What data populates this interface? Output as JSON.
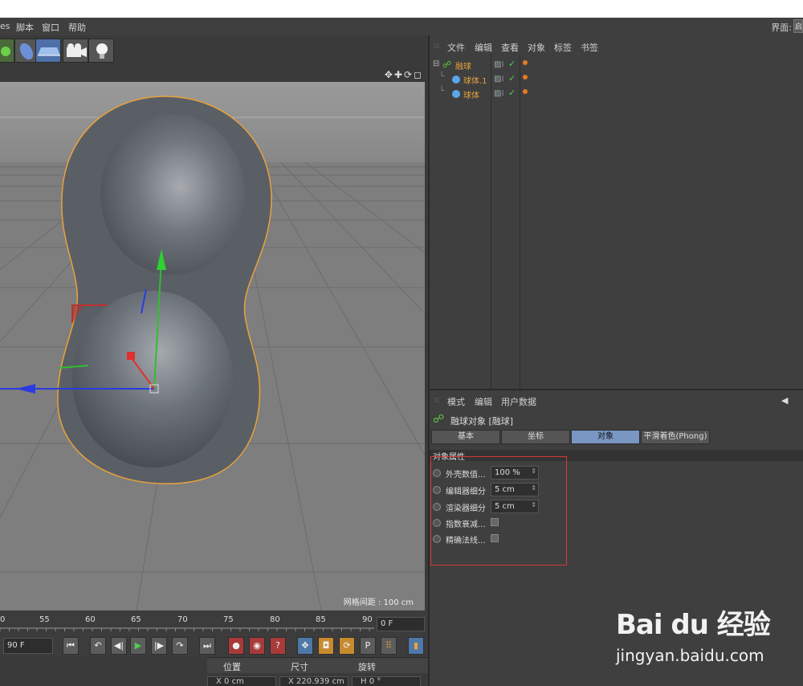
{
  "menubar": {
    "items": [
      "es",
      "脚本",
      "窗口",
      "帮助"
    ],
    "layout_label": "界面:",
    "layout_value": "启"
  },
  "viewport": {
    "grid_spacing": "网格间距 : 100 cm",
    "nav_icons": "✥✚⟳◻"
  },
  "timeline": {
    "ticks": [
      "0",
      "55",
      "60",
      "65",
      "70",
      "75",
      "80",
      "85",
      "90"
    ],
    "current_frame": "0 F"
  },
  "transport": {
    "end_frame": "90 F",
    "buttons": [
      "⏮",
      "↶",
      "◀|",
      "▶",
      "|▶",
      "↷",
      "⏭"
    ]
  },
  "coords": {
    "headers": [
      "位置",
      "尺寸",
      "旋转"
    ],
    "position_x": "X 0 cm",
    "size_x": "X 220.939 cm",
    "rot_h": "H 0 °"
  },
  "object_manager": {
    "menu": [
      "文件",
      "编辑",
      "查看",
      "对象",
      "标签",
      "书签"
    ],
    "objects": [
      {
        "name": "融球",
        "type": "metaball",
        "indent": 0
      },
      {
        "name": "球体.1",
        "type": "sphere",
        "indent": 1
      },
      {
        "name": "球体",
        "type": "sphere",
        "indent": 1
      }
    ]
  },
  "attribute_manager": {
    "menu": [
      "模式",
      "编辑",
      "用户数据"
    ],
    "title": "融球对象 [融球]",
    "tabs": [
      "基本",
      "坐标",
      "对象",
      "平滑着色(Phong)"
    ],
    "active_tab": "对象",
    "section": "对象属性",
    "properties": [
      {
        "label": "外壳数值...",
        "value": "100 %",
        "kind": "field"
      },
      {
        "label": "编辑器细分",
        "value": "5 cm",
        "kind": "field"
      },
      {
        "label": "渲染器细分",
        "value": "5 cm",
        "kind": "field"
      },
      {
        "label": "指数衰减...",
        "value": "",
        "kind": "checkbox"
      },
      {
        "label": "精确法线...",
        "value": "",
        "kind": "checkbox"
      }
    ]
  },
  "watermark": {
    "logo": "Bai du 经验",
    "url": "jingyan.baidu.com"
  },
  "colors": {
    "accent_orange": "#e8a23a",
    "active_tab_blue": "#7a96c2",
    "highlight_red": "#d43a3a"
  }
}
